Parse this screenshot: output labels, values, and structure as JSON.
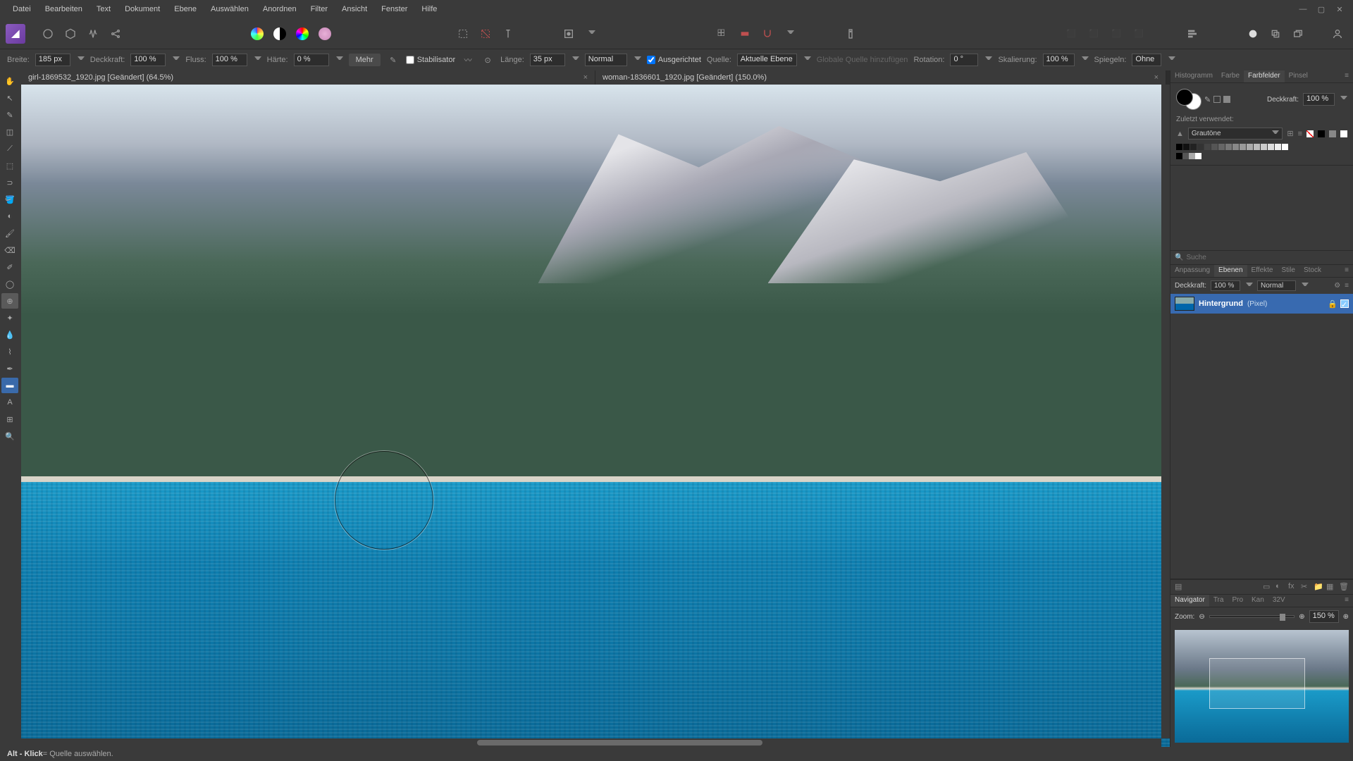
{
  "menu": {
    "items": [
      "Datei",
      "Bearbeiten",
      "Text",
      "Dokument",
      "Ebene",
      "Auswählen",
      "Anordnen",
      "Filter",
      "Ansicht",
      "Fenster",
      "Hilfe"
    ]
  },
  "context": {
    "width_label": "Breite:",
    "width_value": "185 px",
    "opacity_label": "Deckkraft:",
    "opacity_value": "100 %",
    "flow_label": "Fluss:",
    "flow_value": "100 %",
    "hardness_label": "Härte:",
    "hardness_value": "0 %",
    "more": "Mehr",
    "stabilizer": "Stabilisator",
    "length_label": "Länge:",
    "length_value": "35 px",
    "blend_mode": "Normal",
    "aligned": "Ausgerichtet",
    "source_label": "Quelle:",
    "source_value": "Aktuelle Ebene",
    "global_source": "Globale Quelle hinzufügen",
    "rotation_label": "Rotation:",
    "rotation_value": "0 °",
    "scale_label": "Skalierung:",
    "scale_value": "100 %",
    "mirror_label": "Spiegeln:",
    "mirror_value": "Ohne"
  },
  "tabs": [
    {
      "name": "girl-1869532_1920.jpg [Geändert] (64.5%)"
    },
    {
      "name": "woman-1836601_1920.jpg [Geändert] (150.0%)"
    }
  ],
  "right_panel_tabs1": [
    "Histogramm",
    "Farbe",
    "Farbfelder",
    "Pinsel"
  ],
  "right_panel_tabs1_active": "Farbfelder",
  "color_opacity_label": "Deckkraft:",
  "color_opacity_value": "100 %",
  "recent_label": "Zuletzt verwendet:",
  "palette_name": "Grautöne",
  "search_placeholder": "Suche",
  "right_panel_tabs2": [
    "Anpassung",
    "Ebenen",
    "Effekte",
    "Stile",
    "Stock"
  ],
  "right_panel_tabs2_active": "Ebenen",
  "layer_opacity_label": "Deckkraft:",
  "layer_opacity_value": "100 %",
  "layer_blend": "Normal",
  "layer": {
    "name": "Hintergrund",
    "type": "(Pixel)"
  },
  "right_panel_tabs3": [
    "Navigator",
    "Tra",
    "Pro",
    "Kan",
    "32V"
  ],
  "right_panel_tabs3_active": "Navigator",
  "zoom_label": "Zoom:",
  "zoom_value": "150 %",
  "status_key": "Alt - Klick",
  "status_desc": " = Quelle auswählen."
}
